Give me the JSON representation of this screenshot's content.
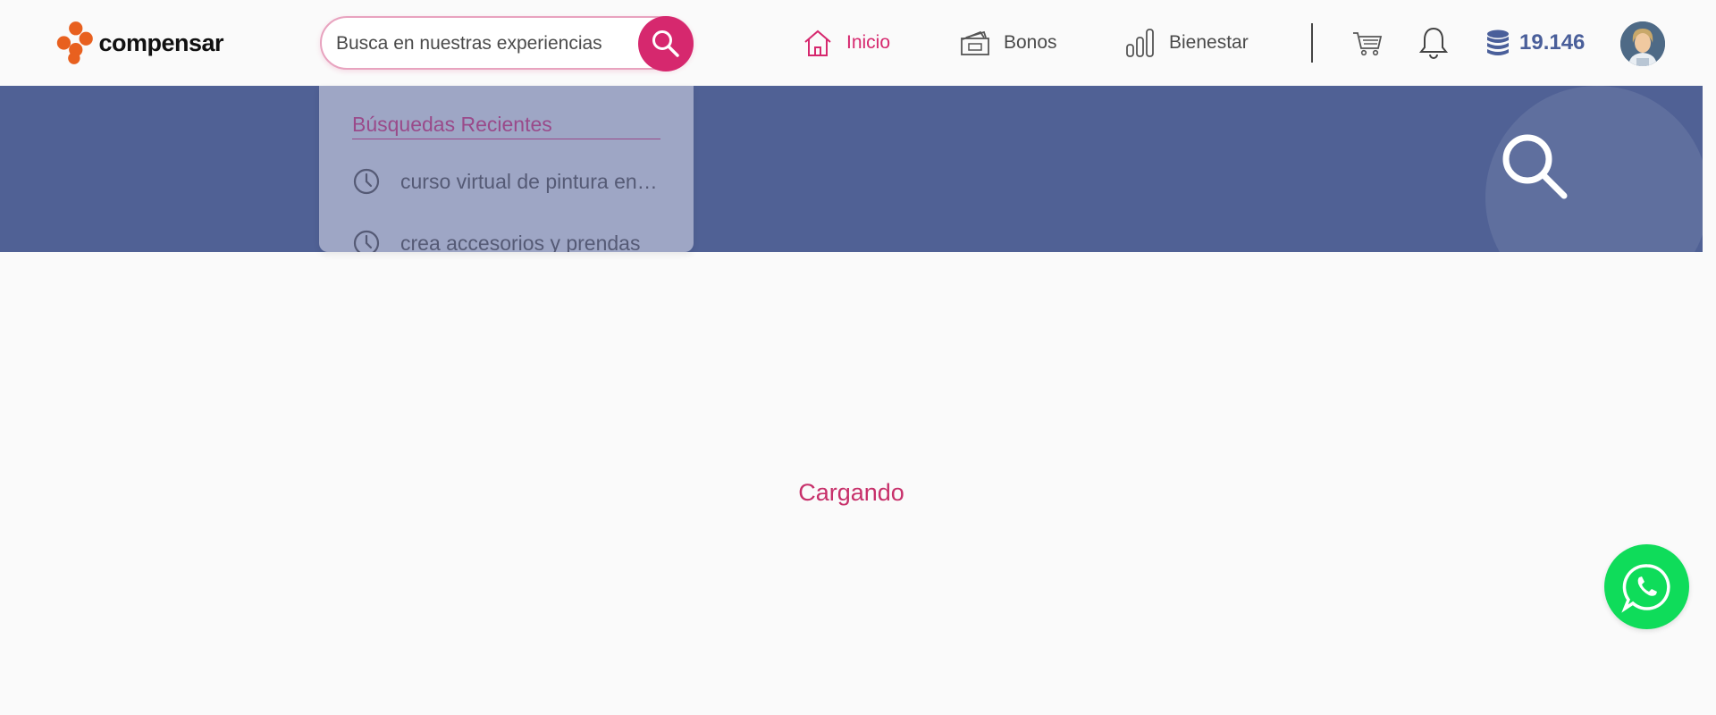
{
  "brand": {
    "name": "compensar",
    "logo_color": "#e8601f"
  },
  "search": {
    "placeholder": "Busca en nuestras experiencias",
    "value": ""
  },
  "nav": {
    "items": [
      {
        "label": "Inicio",
        "icon": "home-icon",
        "active": true
      },
      {
        "label": "Bonos",
        "icon": "voucher-icon",
        "active": false
      },
      {
        "label": "Bienestar",
        "icon": "bar-chart-icon",
        "active": false
      }
    ]
  },
  "header": {
    "points": "19.146"
  },
  "dropdown": {
    "title": "Búsquedas Recientes",
    "items": [
      {
        "text": "curso virtual de pintura en acuarela",
        "icon": "clock-icon"
      },
      {
        "text": "crea accesorios y prendas",
        "icon": "clock-icon"
      }
    ]
  },
  "main": {
    "loading_text": "Cargando"
  },
  "colors": {
    "accent": "#d6286e",
    "banner": "#506195",
    "whatsapp": "#0fdc5a",
    "points": "#4a5f9a"
  }
}
